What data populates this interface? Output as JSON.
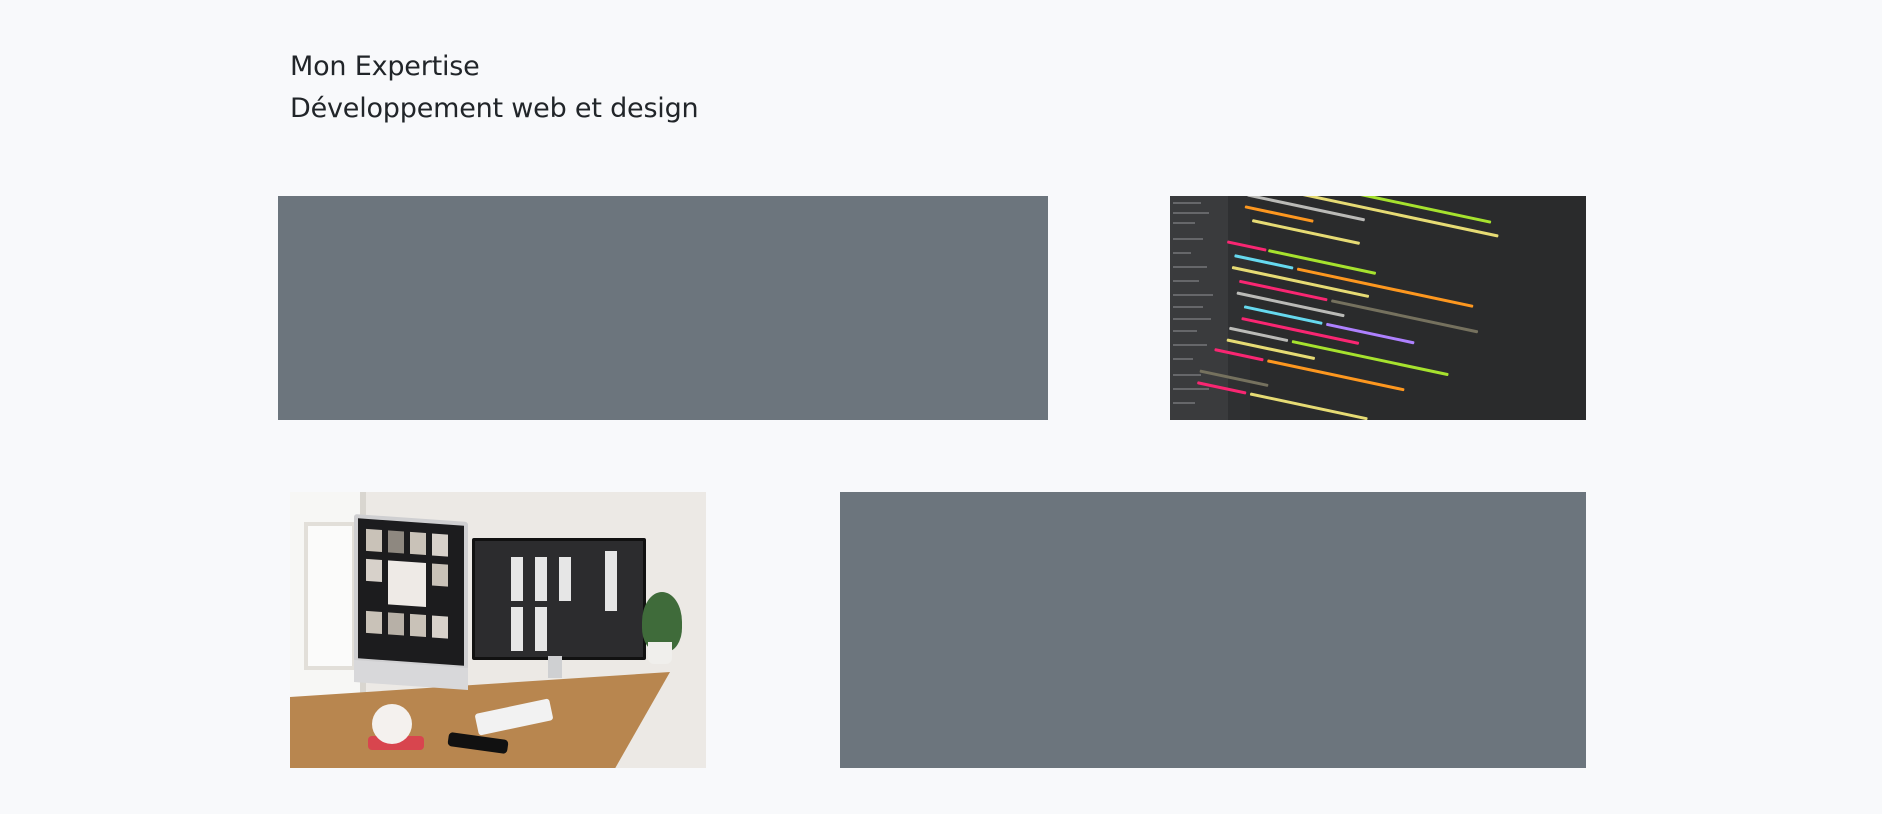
{
  "heading": {
    "line1": "Mon Expertise",
    "line2": "Développement web et design"
  },
  "panels": {
    "placeholder_color": "#6c757d",
    "top_right_image": "code-editor-photo",
    "bottom_left_image": "desk-computers-photo"
  }
}
